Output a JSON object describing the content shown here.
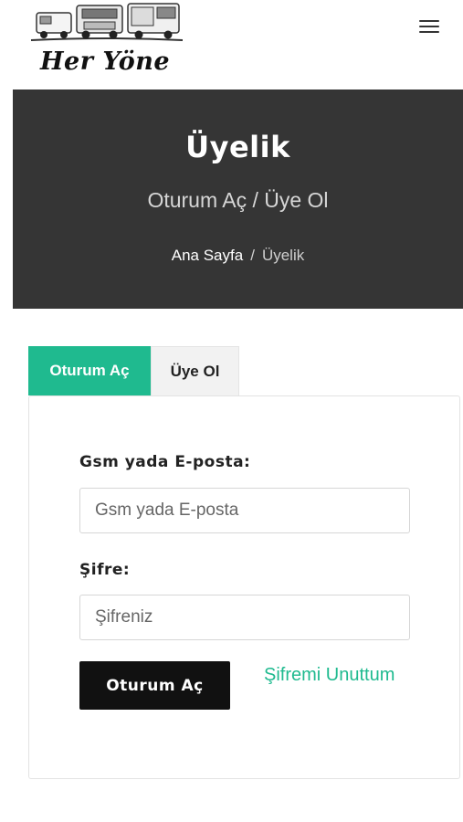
{
  "header": {
    "logo_text": "Her Yöne",
    "menu_icon": "hamburger-menu-icon"
  },
  "banner": {
    "title": "Üyelik",
    "subtitle": "Oturum Aç / Üye Ol",
    "breadcrumb": {
      "home": "Ana Sayfa",
      "separator": "/",
      "current": "Üyelik"
    }
  },
  "tabs": [
    {
      "label": "Oturum Aç",
      "active": true
    },
    {
      "label": "Üye Ol",
      "active": false
    }
  ],
  "login_form": {
    "identifier_label": "Gsm yada E-posta:",
    "identifier_placeholder": "Gsm yada E-posta",
    "password_label": "Şifre:",
    "password_placeholder": "Şifreniz",
    "submit_label": "Oturum Aç",
    "forgot_label": "Şifremi Unuttum"
  },
  "colors": {
    "accent": "#1fba8f",
    "banner_bg": "#353535",
    "button_bg": "#111111"
  }
}
